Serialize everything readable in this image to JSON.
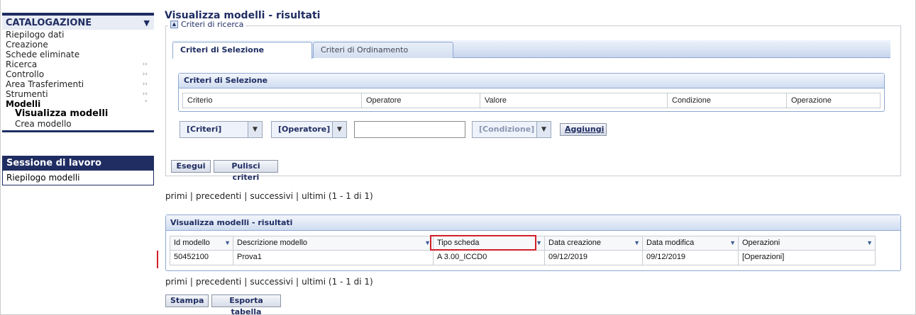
{
  "sidebar": {
    "header": "CATALOGAZIONE",
    "items": [
      {
        "label": "Riepilogo dati",
        "chevron": false,
        "bold": false
      },
      {
        "label": "Creazione",
        "chevron": false,
        "bold": false
      },
      {
        "label": "Schede eliminate",
        "chevron": false,
        "bold": false
      },
      {
        "label": "Ricerca",
        "chevron": true,
        "bold": false
      },
      {
        "label": "Controllo",
        "chevron": true,
        "bold": false
      },
      {
        "label": "Area Trasferimenti",
        "chevron": true,
        "bold": false
      },
      {
        "label": "Strumenti",
        "chevron": true,
        "bold": false
      },
      {
        "label": "Modelli",
        "chevron": true,
        "bold": true
      }
    ],
    "subitems": [
      "Visualizza modelli",
      "Crea modello"
    ],
    "session": {
      "title": "Sessione di lavoro",
      "item": "Riepilogo modelli"
    }
  },
  "page_title": "Visualizza modelli - risultati",
  "search": {
    "legend": "Criteri di ricerca",
    "tabs": [
      "Criteri di Selezione",
      "Criteri di Ordinamento"
    ],
    "panel_title": "Criteri di Selezione",
    "columns": [
      "Criterio",
      "Operatore",
      "Valore",
      "Condizione",
      "Operazione"
    ],
    "criteri_select": "[Criteri]",
    "operatore_select": "[Operatore]",
    "valore_input": "",
    "condizione_select": "[Condizione]",
    "aggiungi": "Aggiungi",
    "esegui": "Esegui",
    "pulisci": "Pulisci criteri"
  },
  "pager": {
    "primi": "primi",
    "precedenti": "precedenti",
    "successivi": "successivi",
    "ultimi": "ultimi",
    "range": "(1 - 1 di 1)"
  },
  "results": {
    "title": "Visualizza modelli - risultati",
    "columns": [
      "Id modello",
      "Descrizione modello",
      "Tipo scheda",
      "Data creazione",
      "Data modifica",
      "Operazioni"
    ],
    "rows": [
      [
        "50452100",
        "Prova1",
        "A 3.00_ICCD0",
        "09/12/2019",
        "09/12/2019",
        "[Operazioni]"
      ]
    ]
  },
  "footer": {
    "stampa": "Stampa",
    "esporta": "Esporta tabella"
  },
  "icons": {
    "collapse": "triangle-down-icon",
    "legend_toggle": "triangle-up-icon",
    "submenu": "double-chevron-icon",
    "sort": "triangle-down-icon"
  },
  "colors": {
    "navy": "#1f2d62",
    "highlight": "#d21f2a",
    "panel_border": "#8ea7d2"
  }
}
